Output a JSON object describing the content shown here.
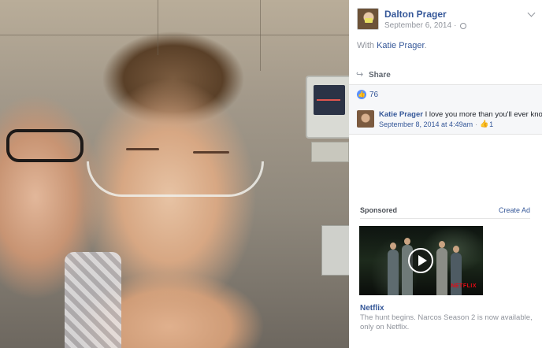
{
  "post": {
    "author": "Dalton Prager",
    "date": "September 6, 2014",
    "with_prefix": "With",
    "tagged_name": "Katie Prager",
    "tagged_suffix": ".",
    "share_label": "Share",
    "like_count": "76"
  },
  "comment": {
    "author": "Katie Prager",
    "text": "I love you more than you'll ever know",
    "timestamp": "September 8, 2014 at 4:49am",
    "separator": "·",
    "like_count": "1"
  },
  "sponsored": {
    "label": "Sponsored",
    "create_ad": "Create Ad",
    "ad_title": "Netflix",
    "ad_description": "The hunt begins. Narcos Season 2 is now available, only on Netflix.",
    "video_mark": "NETFLIX"
  },
  "icons": {
    "privacy": "globe-icon",
    "share": "share-icon",
    "like": "like-badge-icon",
    "options": "chevron-down-icon",
    "video": "play-button-icon"
  },
  "colors": {
    "link": "#365899",
    "like_blue": "#5890ff",
    "muted": "#90949c"
  }
}
